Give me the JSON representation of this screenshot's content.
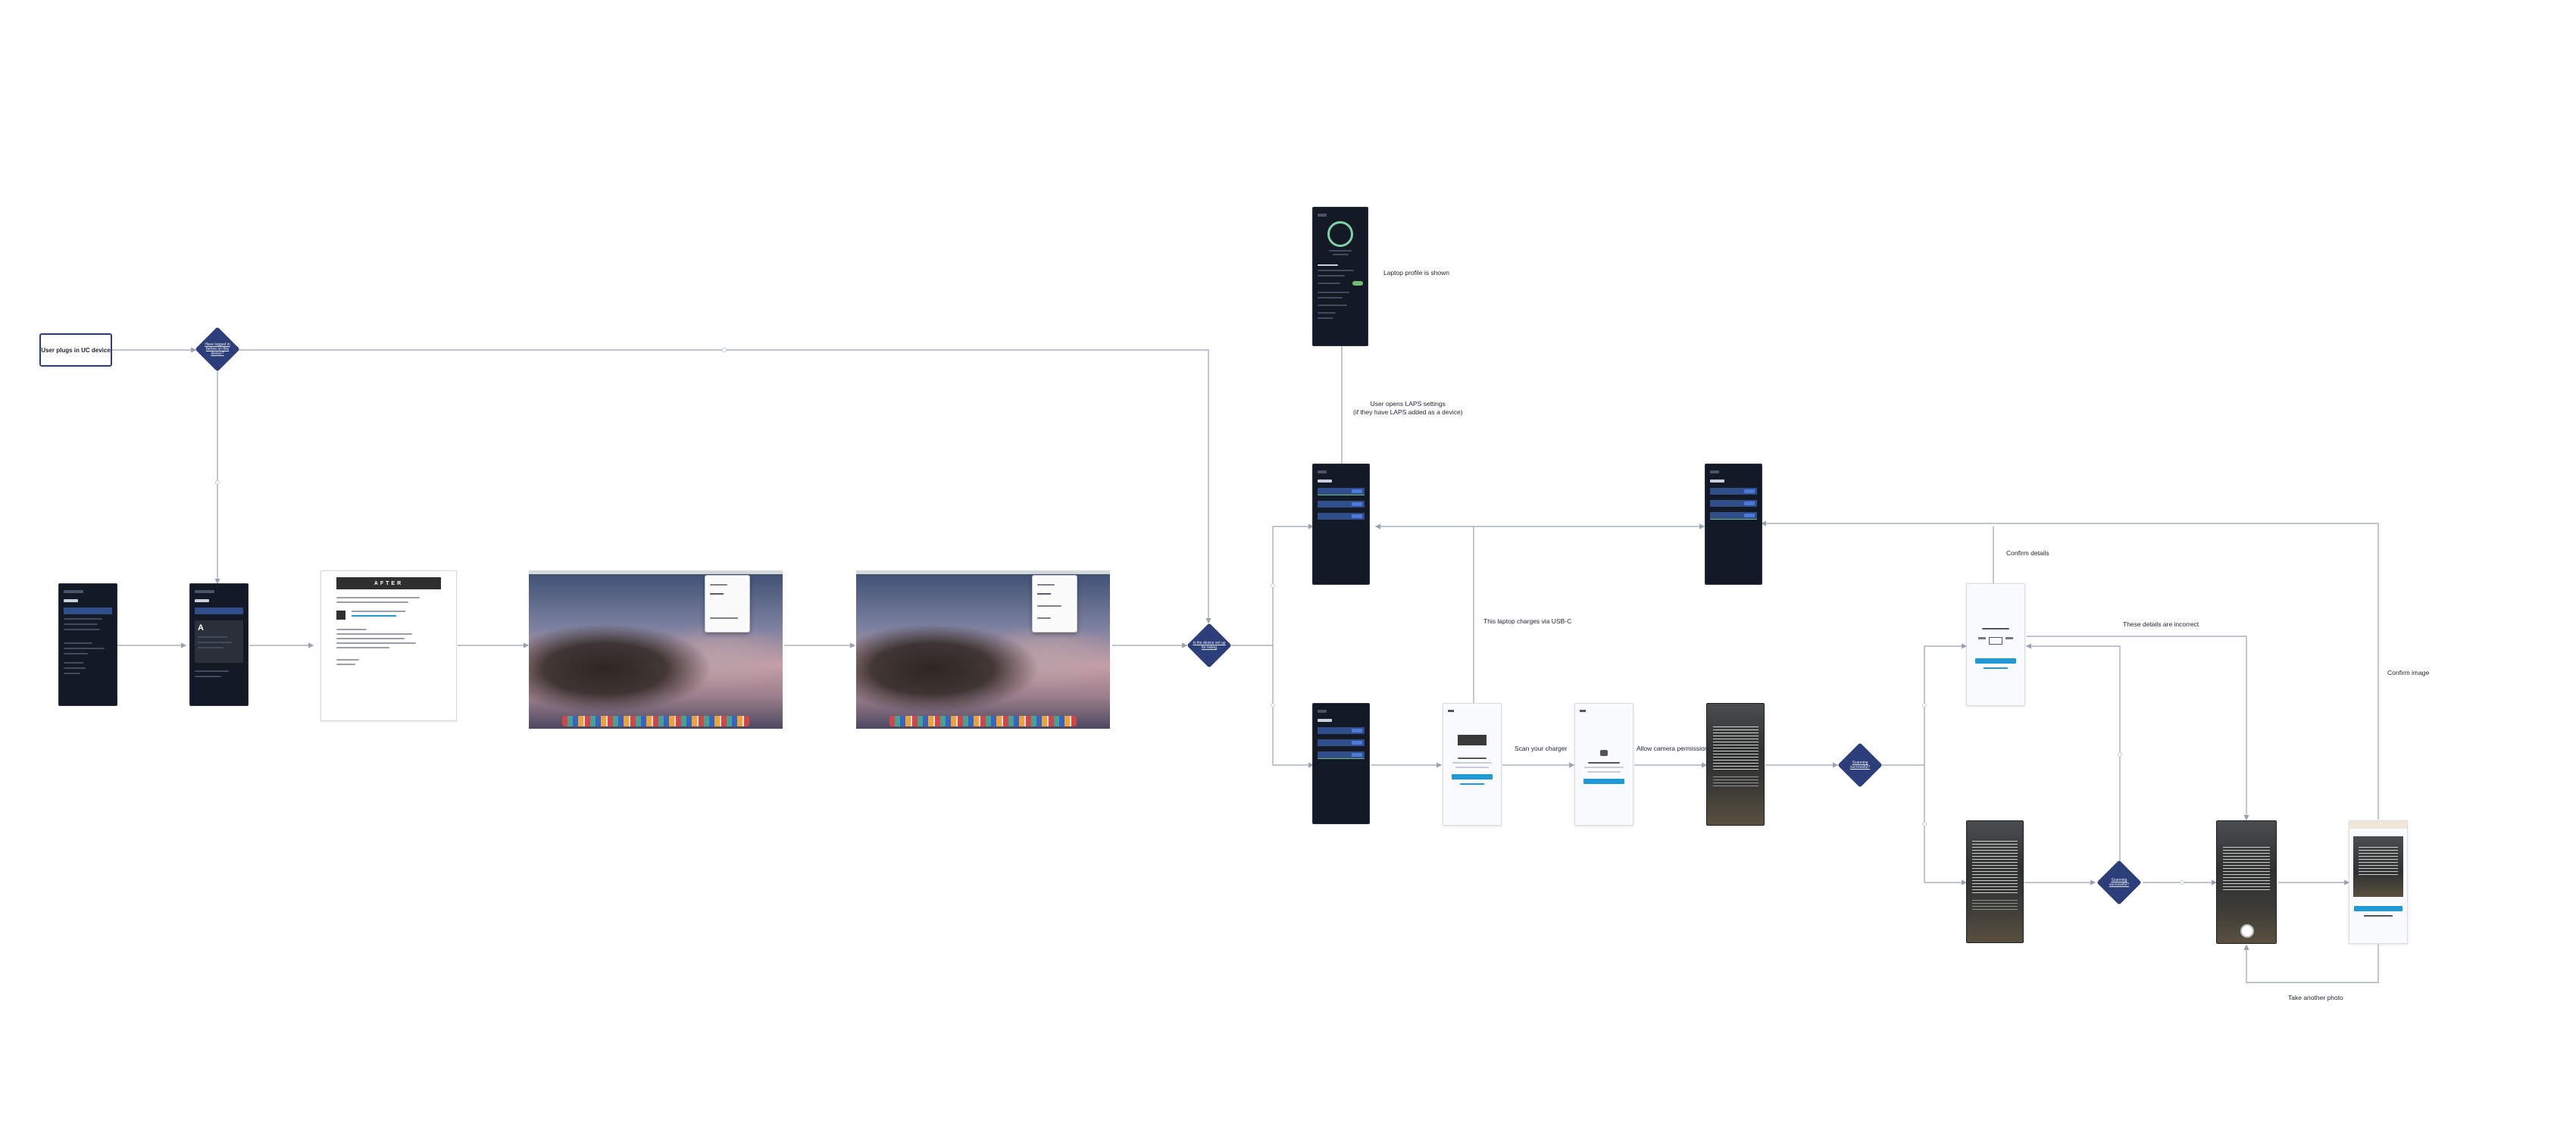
{
  "flow": {
    "start_label": "User plugs in UC device",
    "decisions": {
      "d1": "Have logged in before on this device?",
      "d2": "Is the device set up for listing",
      "d3": "Scanning successful?",
      "d4": "Scanning successful?"
    },
    "edge_labels": {
      "profile_shown": "Laptop profile is shown",
      "opens_settings": "User opens LAPS settings\n(if they have LAPS added as a device)",
      "charges": "This laptop charges via USB-C",
      "scan_charger": "Scan your charger",
      "allow_camera": "Allow camera permission",
      "confirm_details": "Confirm details",
      "details_incorrect": "These details are incorrect",
      "confirm_image": "Confirm image",
      "take_another": "Take another photo"
    },
    "email_logo": "AFTER",
    "device_icon_letter": "A"
  },
  "colors": {
    "diamond": "#2d3f7a",
    "connector": "#9aa3b2",
    "dark_screen": "#131a26",
    "accent_blue": "#1f9ad6",
    "accent_green": "#6fbf73"
  }
}
